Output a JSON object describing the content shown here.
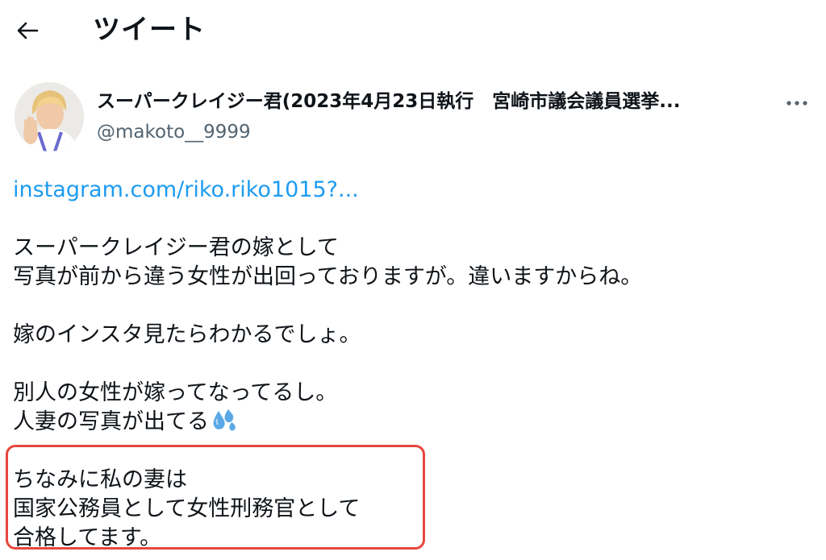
{
  "header": {
    "back_icon": "arrow-left-icon",
    "title": "ツイート"
  },
  "author": {
    "name": "スーパークレイジー君(2023年4月23日執行　宮崎市議会議員選挙...",
    "handle": "@makoto__9999",
    "more_icon": "more-horizontal-icon"
  },
  "tweet": {
    "link": "instagram.com/riko.riko1015?...",
    "paragraph1": {
      "line1": "スーパークレイジー君の嫁として",
      "line2": "写真が前から違う女性が出回っておりますが。違いますからね。"
    },
    "paragraph2": {
      "line1": "嫁のインスタ見たらわかるでしょ。"
    },
    "paragraph3": {
      "line1": "別人の女性が嫁ってなってるし。",
      "line2": "人妻の写真が出てる",
      "emoji": "sweat-droplets-icon"
    },
    "paragraph4": {
      "line1": "ちなみに私の妻は",
      "line2": "国家公務員として女性刑務官として",
      "line3": "合格してます。"
    }
  },
  "colors": {
    "link": "#1d9bf0",
    "handle": "#536471",
    "text": "#0f1419",
    "highlight_border": "#e5473e"
  }
}
